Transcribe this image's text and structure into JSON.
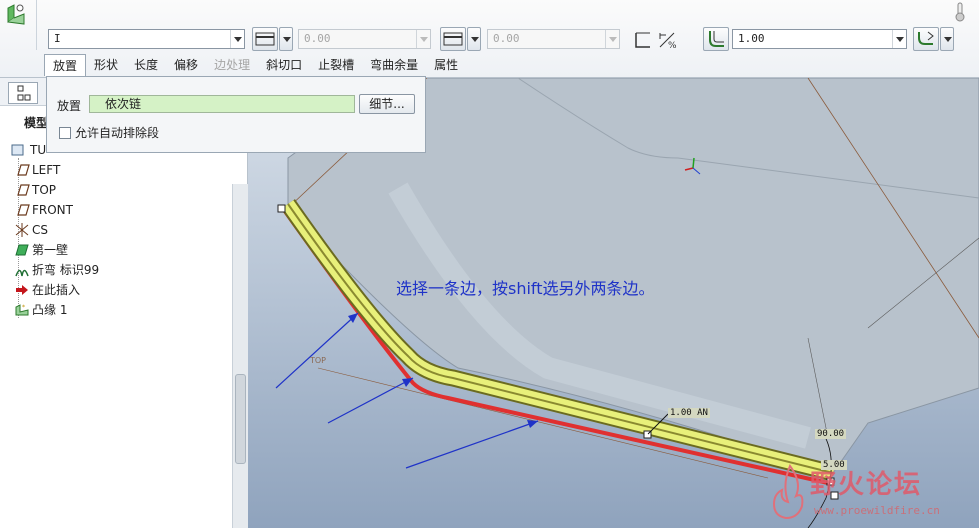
{
  "dashboard": {
    "type_value": "I",
    "width_value": "0.00",
    "offset_value": "0.00",
    "radius_value": "1.00"
  },
  "tabs": [
    {
      "label": "放置",
      "active": true,
      "disabled": false
    },
    {
      "label": "形状",
      "active": false,
      "disabled": false
    },
    {
      "label": "长度",
      "active": false,
      "disabled": false
    },
    {
      "label": "偏移",
      "active": false,
      "disabled": false
    },
    {
      "label": "边处理",
      "active": false,
      "disabled": true
    },
    {
      "label": "斜切口",
      "active": false,
      "disabled": false
    },
    {
      "label": "止裂槽",
      "active": false,
      "disabled": false
    },
    {
      "label": "弯曲余量",
      "active": false,
      "disabled": false
    },
    {
      "label": "属性",
      "active": false,
      "disabled": false
    }
  ],
  "placement_panel": {
    "label": "放置",
    "chain_value": "依次链",
    "detail_button": "细节...",
    "auto_exclude_label": "允许自动排除段"
  },
  "model_tree": {
    "title": "模型",
    "root": "TU",
    "items": [
      {
        "label": "LEFT",
        "icon": "datum-plane-icon"
      },
      {
        "label": "TOP",
        "icon": "datum-plane-icon"
      },
      {
        "label": "FRONT",
        "icon": "datum-plane-icon"
      },
      {
        "label": "CS",
        "icon": "coordinate-system-icon"
      },
      {
        "label": "第一壁",
        "icon": "first-wall-icon"
      },
      {
        "label": "折弯 标识99",
        "icon": "bend-icon"
      },
      {
        "label": "在此插入",
        "icon": "insert-here-arrow-icon"
      },
      {
        "label": "凸缘 1",
        "icon": "flange-icon"
      }
    ]
  },
  "viewport": {
    "instruction": "选择一条边，按shift选另外两条边。",
    "dim_radius": "1.00 AN",
    "dim_angle": "90.00",
    "dim_length": "5.00",
    "datum_label": "TOP"
  },
  "watermark": {
    "title": "野火论坛",
    "url": "www.proewildfire.cn"
  },
  "colors": {
    "chain_highlight": "#d5f2c6",
    "instruction_text": "#1f33c8",
    "selected_edge": "#e8f07a",
    "preview_edge": "#e03030"
  }
}
